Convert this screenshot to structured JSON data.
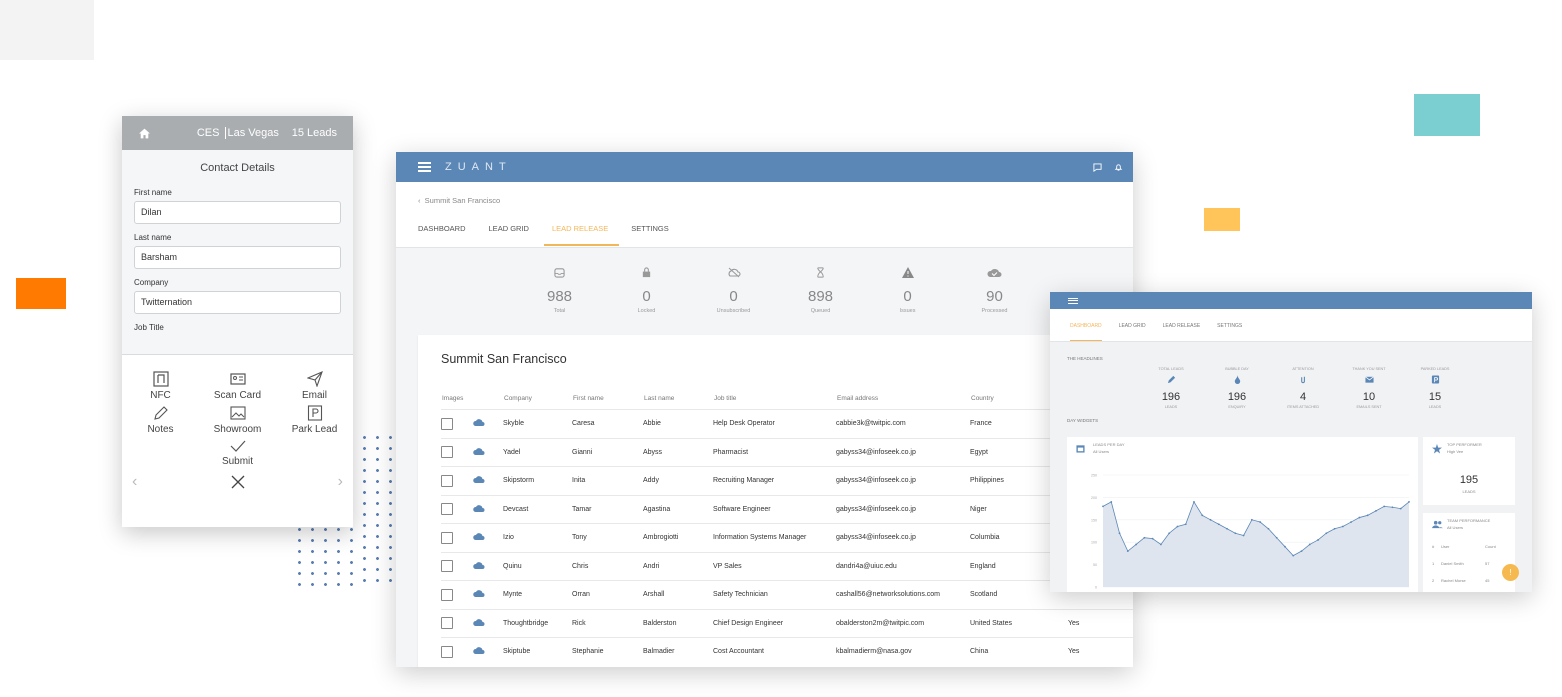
{
  "phone": {
    "event_name": "CES",
    "event_city": "Las Vegas",
    "leads_count": "15 Leads",
    "title": "Contact Details",
    "fields": [
      {
        "label": "First name",
        "value": "Dilan"
      },
      {
        "label": "Last name",
        "value": "Barsham"
      },
      {
        "label": "Company",
        "value": "Twitternation"
      }
    ],
    "job_title_label": "Job Title",
    "actions": [
      {
        "label": "NFC",
        "icon": "nfc-icon"
      },
      {
        "label": "Scan Card",
        "icon": "id-card-icon"
      },
      {
        "label": "Email",
        "icon": "send-icon"
      },
      {
        "label": "Notes",
        "icon": "pencil-icon"
      },
      {
        "label": "Showroom",
        "icon": "image-icon"
      },
      {
        "label": "Park Lead",
        "icon": "parking-icon"
      }
    ],
    "submit_label": "Submit"
  },
  "main": {
    "logo": "ZUANT",
    "breadcrumb": "Summit San Francisco",
    "tabs": [
      "DASHBOARD",
      "LEAD GRID",
      "LEAD RELEASE",
      "SETTINGS"
    ],
    "active_tab": "LEAD RELEASE",
    "stats": [
      {
        "value": "988",
        "label": "Total",
        "icon": "inbox-icon"
      },
      {
        "value": "0",
        "label": "Locked",
        "icon": "lock-icon"
      },
      {
        "value": "0",
        "label": "Unsubscribed",
        "icon": "cloud-off-icon"
      },
      {
        "value": "898",
        "label": "Queued",
        "icon": "hourglass-icon"
      },
      {
        "value": "0",
        "label": "Issues",
        "icon": "warning-icon"
      },
      {
        "value": "90",
        "label": "Processed",
        "icon": "cloud-done-icon"
      }
    ],
    "card_title": "Summit San Francisco",
    "columns": [
      "Images",
      "Company",
      "First name",
      "Last name",
      "Job title",
      "Email address",
      "Country",
      ""
    ],
    "rows": [
      [
        "Skyble",
        "Caresa",
        "Abbie",
        "Help Desk Operator",
        "cabbie3k@twitpic.com",
        "France",
        ""
      ],
      [
        "Yadel",
        "Gianni",
        "Abyss",
        "Pharmacist",
        "gabyss34@infoseek.co.jp",
        "Egypt",
        ""
      ],
      [
        "Skipstorm",
        "Inita",
        "Addy",
        "Recruiting Manager",
        "gabyss34@infoseek.co.jp",
        "Philippines",
        ""
      ],
      [
        "Devcast",
        "Tamar",
        "Agastina",
        "Software Engineer",
        "gabyss34@infoseek.co.jp",
        "Niger",
        ""
      ],
      [
        "Izio",
        "Tony",
        "Ambrogiotti",
        "Information Systems Manager",
        "gabyss34@infoseek.co.jp",
        "Columbia",
        ""
      ],
      [
        "Quinu",
        "Chris",
        "Andri",
        "VP Sales",
        "dandri4a@uiuc.edu",
        "England",
        ""
      ],
      [
        "Mynte",
        "Orran",
        "Arshall",
        "Safety Technician",
        "cashall56@networksolutions.com",
        "Scotland",
        ""
      ],
      [
        "Thoughtbridge",
        "Rick",
        "Balderston",
        "Chief Design Engineer",
        "obalderston2m@twitpic.com",
        "United States",
        "Yes"
      ],
      [
        "Skiptube",
        "Stephanie",
        "Balmadier",
        "Cost Accountant",
        "kbalmadierm@nasa.gov",
        "China",
        "Yes"
      ]
    ]
  },
  "secondary": {
    "tabs": [
      "DASHBOARD",
      "LEAD GRID",
      "LEAD RELEASE",
      "SETTINGS"
    ],
    "active_tab": "DASHBOARD",
    "headlines_label": "THE HEADLINES",
    "widgets_label": "DAY WIDGETS",
    "stats": [
      {
        "title": "TOTAL LEADS",
        "value": "196",
        "label": "LEADS"
      },
      {
        "title": "BUBBLE DAY",
        "value": "196",
        "label": "ENQUIRY"
      },
      {
        "title": "ATTENTION",
        "value": "4",
        "label": "ITEMS ATTACHED"
      },
      {
        "title": "THANK YOU SENT",
        "value": "10",
        "label": "EMAILS SENT"
      },
      {
        "title": "PARKED LEADS",
        "value": "15",
        "label": "LEADS"
      }
    ],
    "chart_title": "LEADS PER DAY",
    "chart_subtitle": "All Users",
    "top_title": "TOP PERFORMER",
    "top_sub": "High Vee",
    "top_value": "195",
    "top_label": "LEADS",
    "team_title": "TEAM PERFORMANCE",
    "team_sub": "All Users",
    "team_columns": [
      "#",
      "User",
      "Count"
    ],
    "team_rows": [
      [
        "1",
        "Daniel Smith",
        "57"
      ],
      [
        "2",
        "Rachel Morse",
        "45"
      ]
    ],
    "fab_label": "!"
  },
  "chart_data": {
    "type": "area",
    "title": "LEADS PER DAY",
    "y_ticks": [
      "250",
      "200",
      "150",
      "100",
      "50",
      "0"
    ],
    "ylim": [
      0,
      250
    ],
    "values": [
      180,
      190,
      120,
      80,
      95,
      110,
      108,
      95,
      120,
      135,
      140,
      190,
      160,
      150,
      140,
      130,
      120,
      115,
      150,
      145,
      130,
      110,
      90,
      70,
      80,
      95,
      105,
      120,
      130,
      135,
      145,
      155,
      160,
      170,
      180,
      178,
      175,
      190
    ],
    "color": "#5b87b7"
  }
}
